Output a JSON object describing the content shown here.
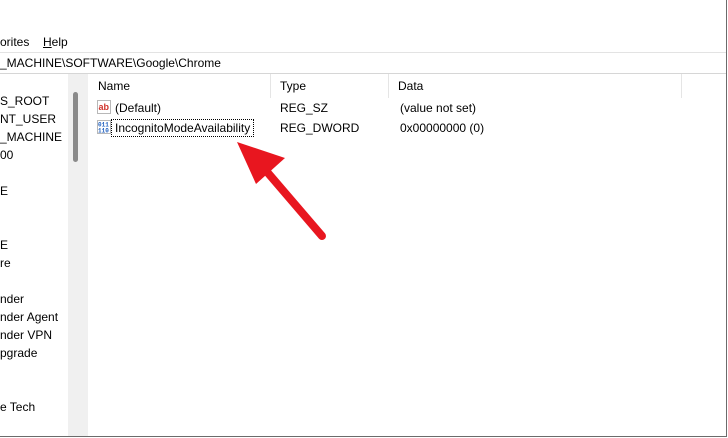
{
  "menubar": {
    "favorites_label": "orites",
    "help_label": "Help",
    "help_underline": "H",
    "help_rest": "elp"
  },
  "address": {
    "path": "_MACHINE\\SOFTWARE\\Google\\Chrome"
  },
  "tree": {
    "items": [
      {
        "label": "S_ROOT"
      },
      {
        "label": "NT_USER"
      },
      {
        "label": "_MACHINE"
      },
      {
        "label": "00"
      },
      {
        "label": "E"
      },
      {
        "label": "E"
      },
      {
        "label": "re"
      },
      {
        "label": "nder"
      },
      {
        "label": "nder Agent"
      },
      {
        "label": "nder VPN"
      },
      {
        "label": "pgrade"
      },
      {
        "label": "e Tech"
      }
    ]
  },
  "list": {
    "columns": [
      "Name",
      "Type",
      "Data"
    ],
    "rows": [
      {
        "name": "(Default)",
        "type": "REG_SZ",
        "data": "(value not set)",
        "icon": "string-value-icon"
      },
      {
        "name": "IncognitoModeAvailability",
        "type": "REG_DWORD",
        "data": "0x00000000 (0)",
        "icon": "dword-value-icon"
      }
    ]
  },
  "annotation": {
    "arrow_color": "#e8161f",
    "icon": "red-arrow-icon"
  }
}
